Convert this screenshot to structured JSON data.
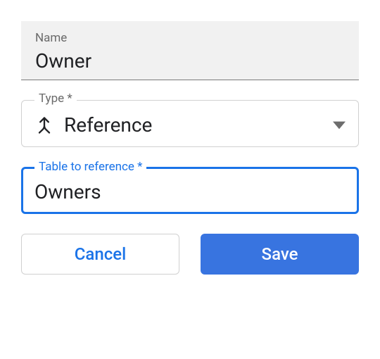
{
  "nameField": {
    "label": "Name",
    "value": "Owner"
  },
  "typeField": {
    "label": "Type *",
    "value": "Reference",
    "icon": "merge-icon"
  },
  "referenceField": {
    "label": "Table to reference *",
    "value": "Owners"
  },
  "buttons": {
    "cancel": "Cancel",
    "save": "Save"
  }
}
